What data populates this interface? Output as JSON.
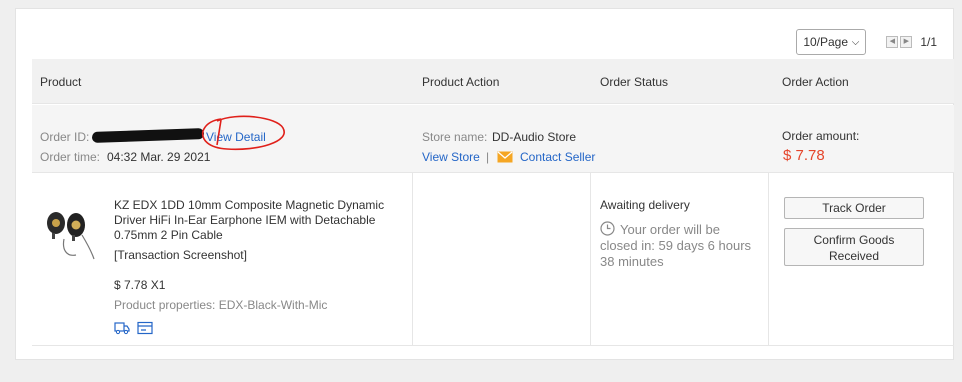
{
  "pager": {
    "page_size": "10/Page",
    "page_info": "1/1"
  },
  "header": {
    "product": "Product",
    "product_action": "Product Action",
    "order_status": "Order Status",
    "order_action": "Order Action"
  },
  "order": {
    "id_label": "Order ID:",
    "view_detail": "View Detail",
    "time_label": "Order time:",
    "time_value": "04:32 Mar. 29 2021",
    "store_label": "Store name:",
    "store_name": "DD-Audio Store",
    "view_store": "View Store",
    "separator": "|",
    "contact_seller": "Contact Seller",
    "amount_label": "Order amount:",
    "amount_value": "$ 7.78"
  },
  "item": {
    "title_line1": "KZ EDX 1DD 10mm Composite Magnetic Dynamic",
    "title_line2": "Driver HiFi In-Ear Earphone IEM with Detachable",
    "title_line3": "0.75mm 2 Pin Cable",
    "screenshot_link": "[Transaction Screenshot]",
    "price_qty": "$ 7.78 X1",
    "properties": "Product properties: EDX-Black-With-Mic",
    "status": "Awaiting delivery",
    "close_line1": "Your order will be",
    "close_line2": "closed in: 59 days 6 hours",
    "close_line3": "38 minutes",
    "track_order": "Track Order",
    "confirm_line1": "Confirm Goods",
    "confirm_line2": "Received"
  },
  "colors": {
    "link": "#2466c7",
    "price": "#e5452b",
    "annotation": "#e0201a",
    "mail_icon": "#f5a623"
  },
  "icons": [
    "chevron-down-icon",
    "prev-page-icon",
    "next-page-icon",
    "mail-icon",
    "clock-icon",
    "truck-icon",
    "card-icon"
  ]
}
